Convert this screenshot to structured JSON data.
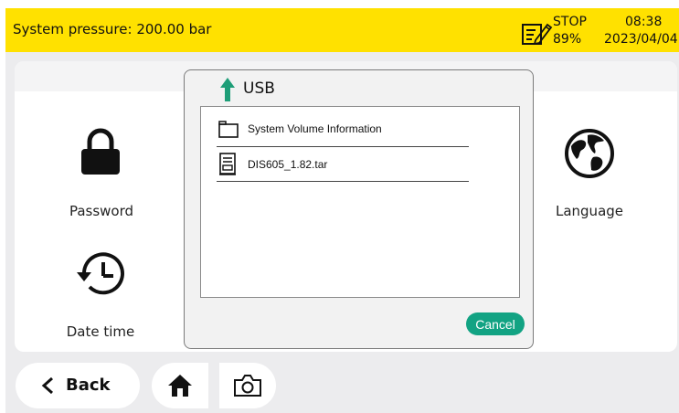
{
  "header": {
    "pressure": "System pressure: 200.00 bar",
    "state": "STOP",
    "percent": "89%",
    "time": "08:38",
    "date": "2023/04/04",
    "icon": "notepad-edit-icon"
  },
  "settings": {
    "password": {
      "label": "Password",
      "icon": "lock-icon"
    },
    "language": {
      "label": "Language",
      "icon": "globe-icon"
    },
    "datetime": {
      "label": "Date time",
      "icon": "history-clock-icon"
    }
  },
  "dialog": {
    "title": "USB",
    "title_icon": "upload-arrow-icon",
    "files": [
      {
        "name": "System Volume Information",
        "icon": "folder-icon"
      },
      {
        "name": "DIS605_1.82.tar",
        "icon": "archive-file-icon"
      }
    ],
    "cancel_label": "Cancel"
  },
  "nav": {
    "back_label": "Back",
    "home_icon": "home-icon",
    "camera_icon": "camera-icon"
  },
  "colors": {
    "header_bg": "#ffe100",
    "accent_green": "#12a383",
    "arrow_green": "#1e9e78",
    "background": "#ececee"
  }
}
